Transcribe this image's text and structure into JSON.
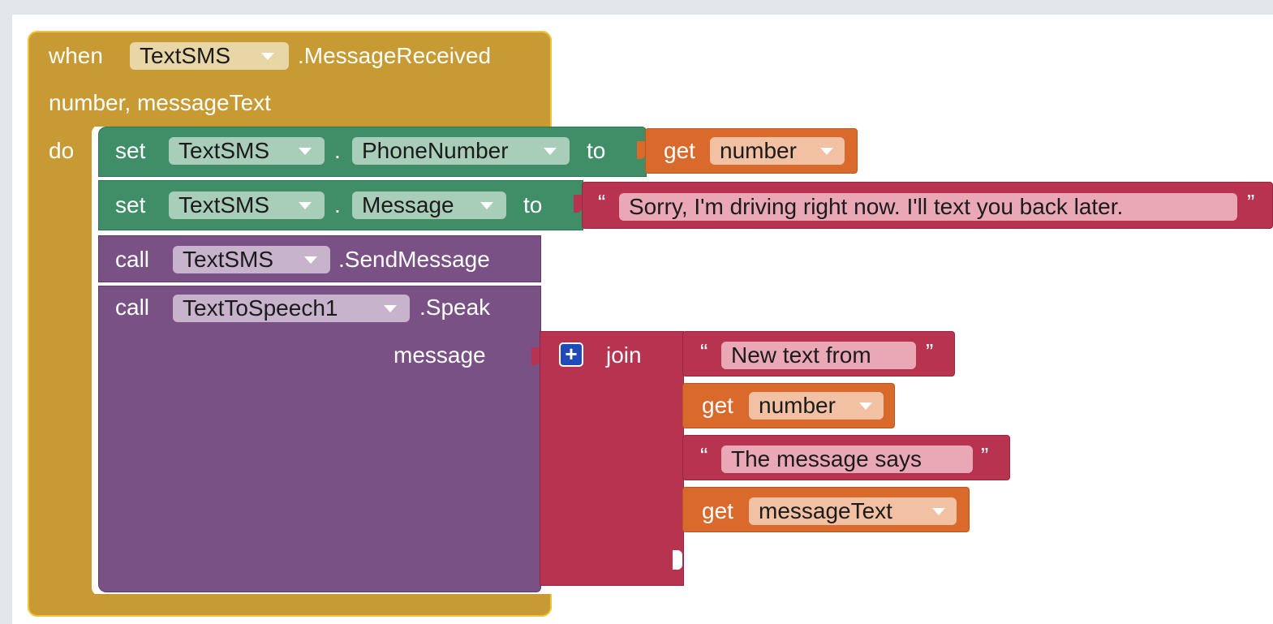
{
  "event_block": {
    "when_label": "when",
    "component": "TextSMS",
    "event_name": ".MessageReceived",
    "params": "number,  messageText",
    "do_label": "do"
  },
  "set_phone": {
    "set_label": "set",
    "component": "TextSMS",
    "dot": ".",
    "property": "PhoneNumber",
    "to_label": "to",
    "get_label": "get",
    "get_var": "number"
  },
  "set_message": {
    "set_label": "set",
    "component": "TextSMS",
    "dot": ".",
    "property": "Message",
    "to_label": "to",
    "open_quote": "“",
    "text": "Sorry, I'm driving right now. I'll text you back later.",
    "close_quote": "”"
  },
  "call_send": {
    "call_label": "call",
    "component": "TextSMS",
    "method": ".SendMessage"
  },
  "call_speak": {
    "call_label": "call",
    "component": "TextToSpeech1",
    "method": ".Speak",
    "arg_label": "message"
  },
  "join_block": {
    "plus": "+",
    "join_label": "join",
    "item1_open": "“",
    "item1_text": "New text from",
    "item1_close": "”",
    "item2_get": "get",
    "item2_var": "number",
    "item3_open": "“",
    "item3_text": "The message says",
    "item3_close": "”",
    "item4_get": "get",
    "item4_var": "messageText"
  },
  "colors": {
    "event": "#c79a34",
    "set": "#3f8e68",
    "call": "#7a5185",
    "get": "#d96a2c",
    "text": "#b7334f"
  }
}
